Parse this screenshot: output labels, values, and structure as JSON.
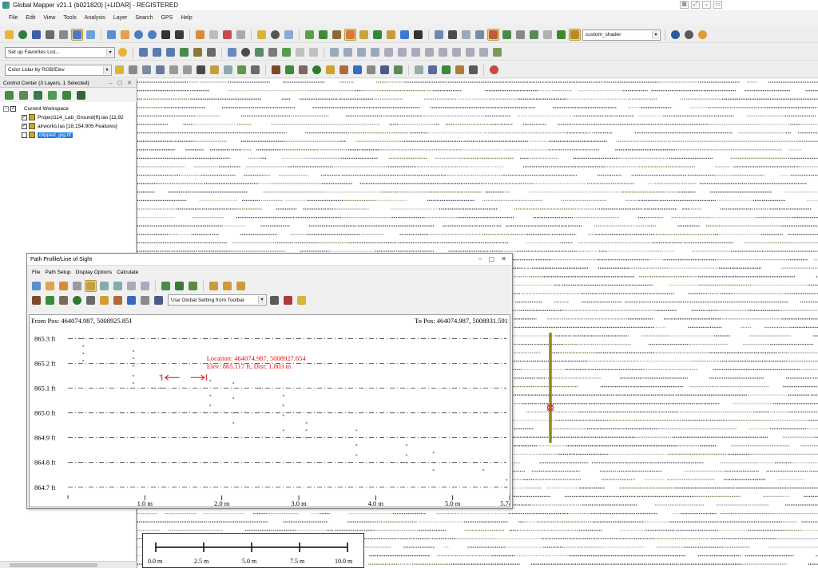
{
  "window": {
    "title": "Global Mapper v21.1 (b021820) [+LIDAR] - REGISTERED"
  },
  "menu": [
    "File",
    "Edit",
    "View",
    "Tools",
    "Analysis",
    "Layer",
    "Search",
    "GPS",
    "Help"
  ],
  "toolbar": {
    "shader_select": "custom_shader",
    "favorites_select": "Set up Favorites List...",
    "lidar_color_select": "Color Lidar by RGB/Elev"
  },
  "control_center": {
    "title": "Control Center (3 Layers, 1 Selected)",
    "workspace_label": "Current Workspace",
    "layers": [
      {
        "name": "Project114_Lab_Ground(ft).las [11,92",
        "checked": true,
        "selected": false
      },
      {
        "name": "airworks.las [18,154,905 Features]",
        "checked": true,
        "selected": false
      },
      {
        "name": "clipped_jpg.tif",
        "checked": false,
        "selected": true
      }
    ]
  },
  "profile_dialog": {
    "title": "Path Profile/Line of Sight",
    "menu": [
      "File",
      "Path Setup",
      "Display Options",
      "Calculate"
    ],
    "elev_setting_select": "Use Global Setting from Toolbar",
    "from_pos": "From Pos: 464074.987, 5008925.851",
    "to_pos": "To Pos: 464074.987, 5008931.591",
    "cursor_location": "Location: 464074.987, 5008927.654",
    "cursor_elev": "Elev: 865.117 ft, Dist: 1.803 m"
  },
  "chart_data": {
    "type": "scatter",
    "title": "",
    "xlabel": "",
    "ylabel": "",
    "x_ticks": [
      "1.0 m",
      "2.0 m",
      "3.0 m",
      "4.0 m",
      "5.0 m",
      "5.74 m"
    ],
    "y_ticks": [
      "865.3 ft",
      "865.2 ft",
      "865.1 ft",
      "865.0 ft",
      "864.9 ft",
      "864.8 ft",
      "864.7 ft"
    ],
    "xlim": [
      0,
      5.74
    ],
    "ylim": [
      864.68,
      865.33
    ],
    "grid": true,
    "series": [
      {
        "x": [
          0.2,
          0.2,
          0.2,
          0.2,
          0.85,
          0.85,
          0.85,
          0.85,
          0.85,
          1.2,
          1.2,
          1.85,
          1.85,
          1.85,
          2.15,
          2.15,
          2.15,
          2.15,
          2.5,
          2.8,
          2.8,
          2.8,
          2.8,
          3.1,
          3.1,
          3.1,
          3.75,
          3.75,
          3.75,
          4.4,
          4.4,
          4.4,
          4.75,
          4.75,
          4.75,
          5.4,
          5.7,
          5.7
        ],
        "y": [
          865.3,
          865.27,
          865.24,
          865.21,
          865.25,
          865.22,
          865.19,
          865.15,
          865.12,
          865.15,
          865.1,
          865.13,
          865.07,
          865.03,
          865.12,
          865.06,
          865.0,
          864.96,
          865.1,
          865.07,
          865.03,
          864.99,
          864.93,
          864.96,
          864.93,
          864.9,
          864.93,
          864.87,
          864.83,
          864.87,
          864.83,
          864.8,
          864.84,
          864.8,
          864.77,
          864.77,
          864.73,
          864.7
        ]
      }
    ],
    "cursor": {
      "x": 1.803,
      "y": 865.117
    }
  },
  "scale_bar": {
    "labels": [
      "0.0 m",
      "2.5 m",
      "5.0 m",
      "7.5 m",
      "10.0 m"
    ]
  }
}
